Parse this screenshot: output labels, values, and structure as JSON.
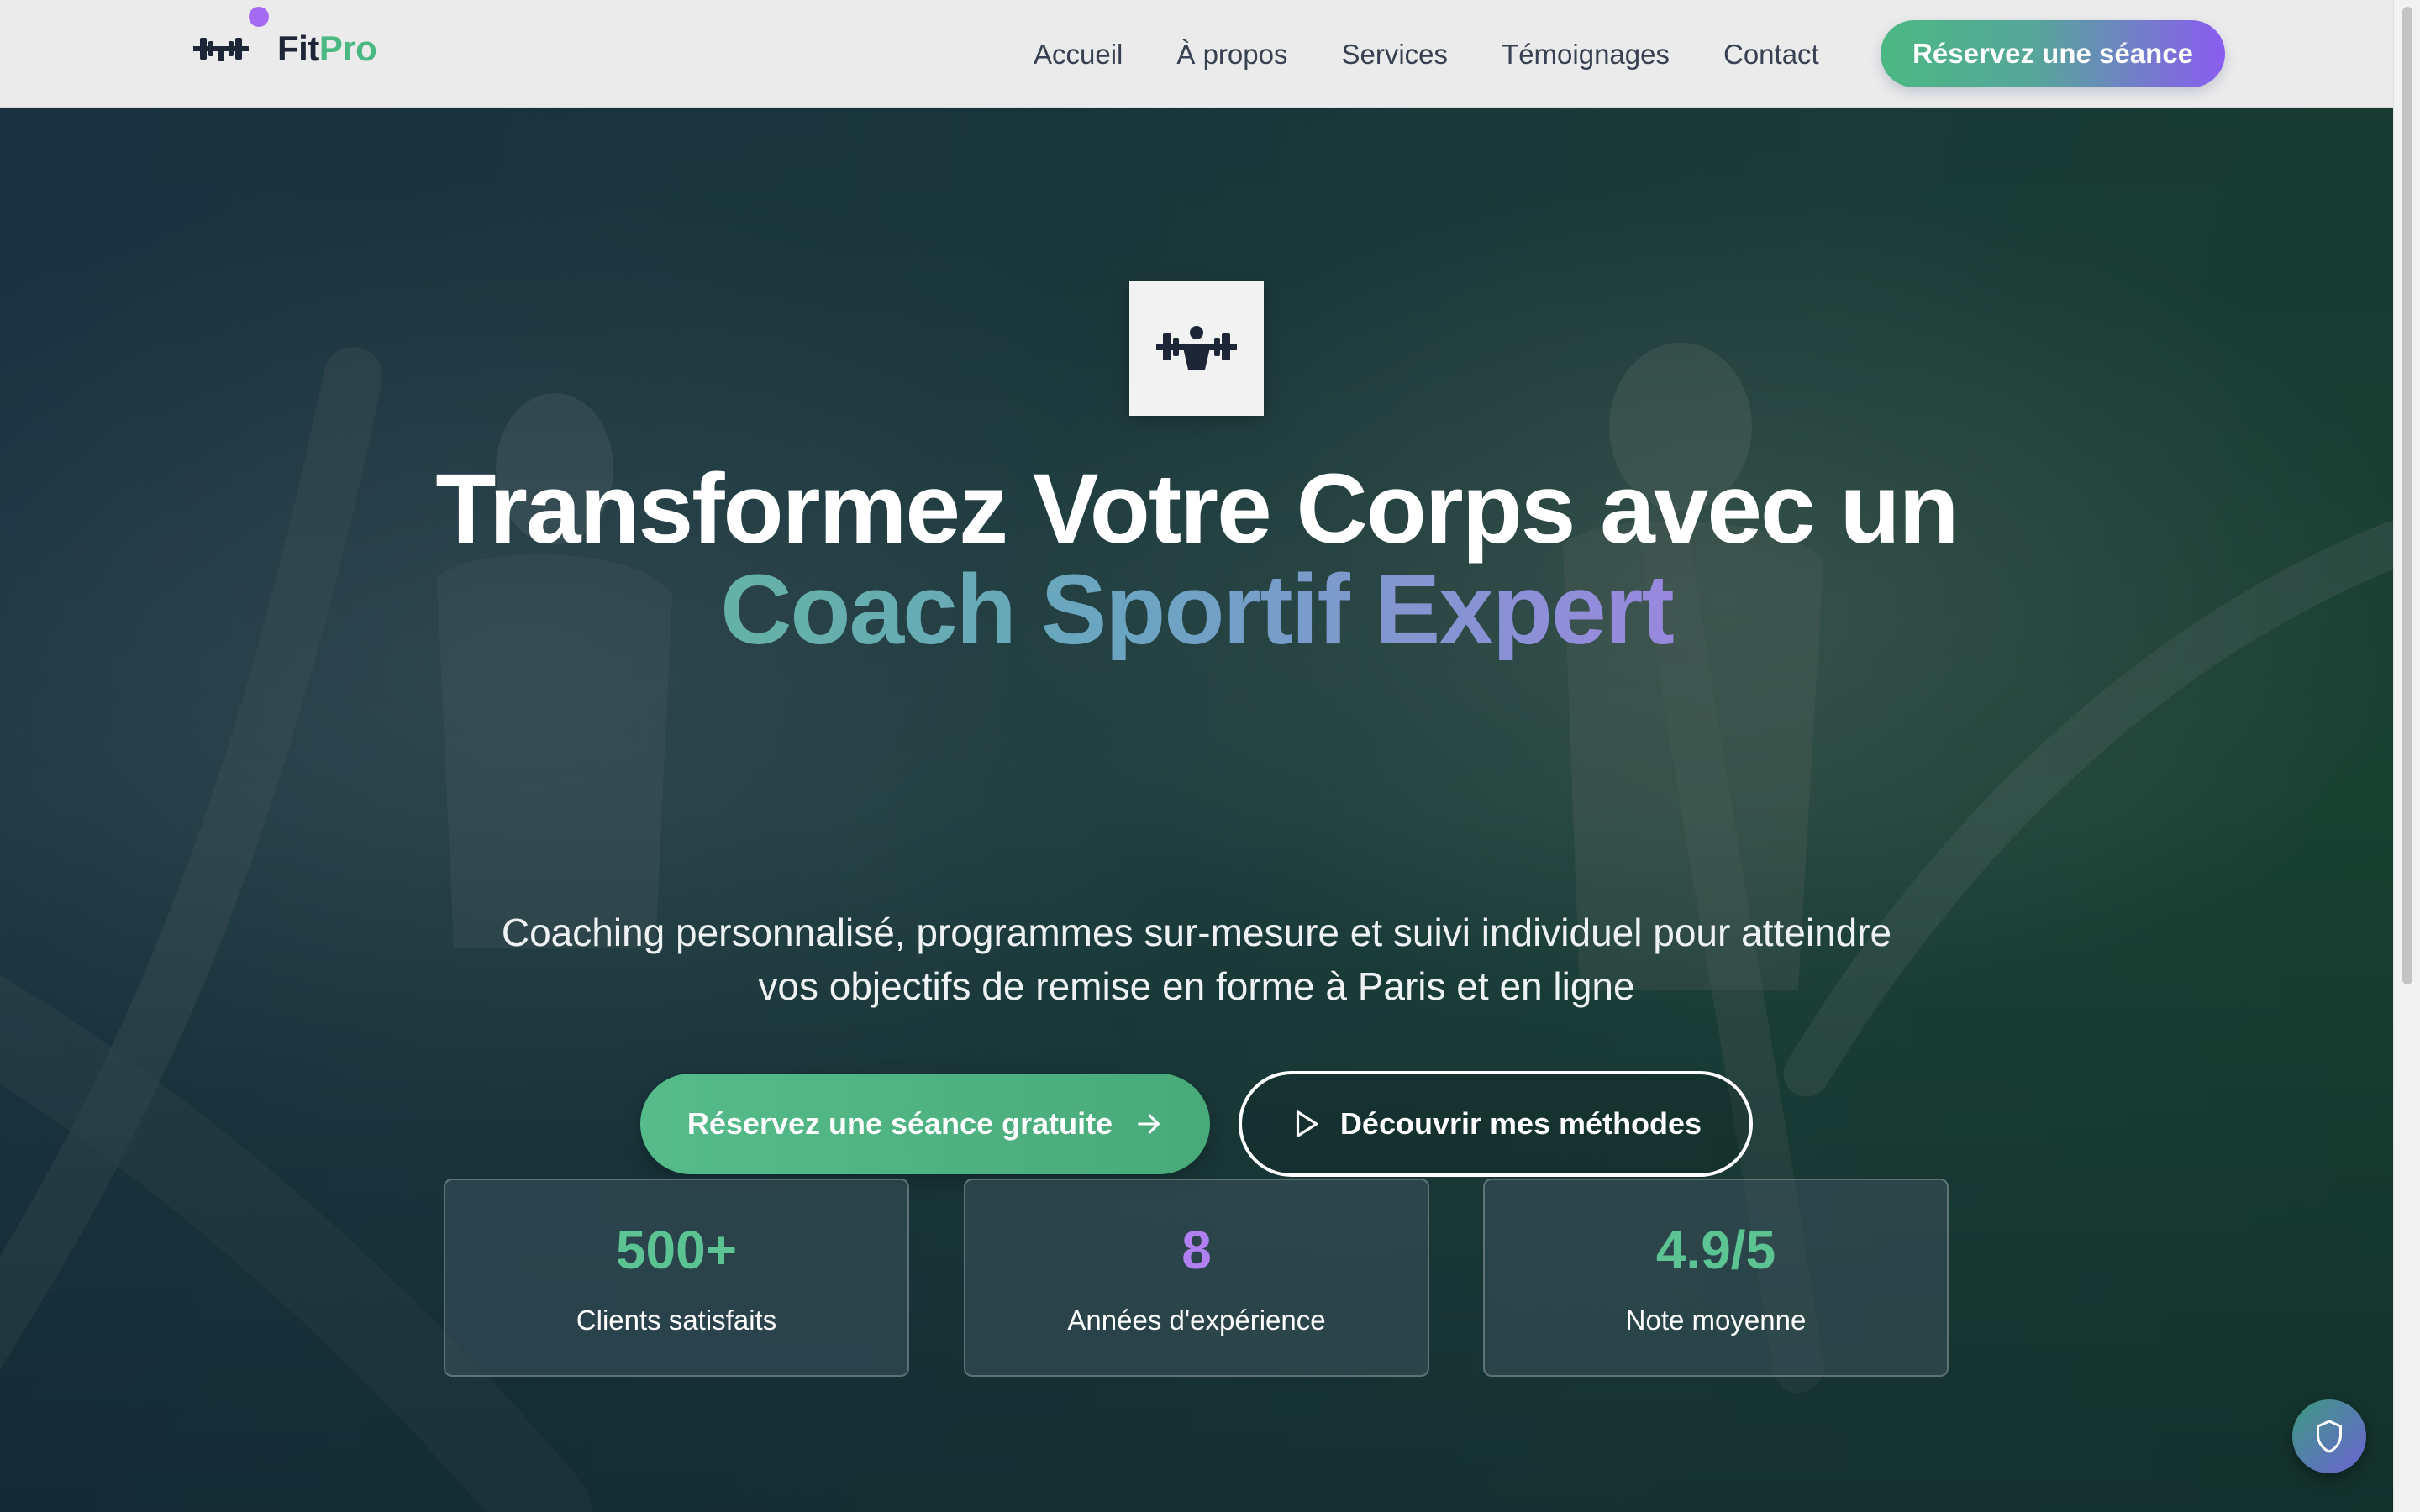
{
  "brand": {
    "name_part1": "Fit",
    "name_part2": "Pro",
    "accent_color": "#4bb883",
    "secondary_color": "#8a5cf0",
    "logo_icon": "barbell-icon"
  },
  "nav": {
    "links": [
      "Accueil",
      "À propos",
      "Services",
      "Témoignages",
      "Contact"
    ],
    "cta_label": "Réservez une séance"
  },
  "hero": {
    "badge_icon": "barbell-lifter-icon",
    "title_line1": "Transformez Votre Corps avec un",
    "title_accent": "Coach Sportif Expert",
    "subtitle": "Coaching personnalisé, programmes sur-mesure et suivi individuel pour atteindre vos objectifs de remise en forme à Paris et en ligne",
    "primary_button": "Réservez une séance gratuite",
    "primary_icon": "arrow-right-icon",
    "secondary_button": "Découvrir mes méthodes",
    "secondary_icon": "play-icon"
  },
  "stats": [
    {
      "value": "500+",
      "label": "Clients satisfaits",
      "color": "#5cc492"
    },
    {
      "value": "8",
      "label": "Années d'expérience",
      "color": "#b07ff0"
    },
    {
      "value": "4.9/5",
      "label": "Note moyenne",
      "color": "#5cc492"
    }
  ],
  "widgets": {
    "privacy_icon": "shield-icon"
  }
}
